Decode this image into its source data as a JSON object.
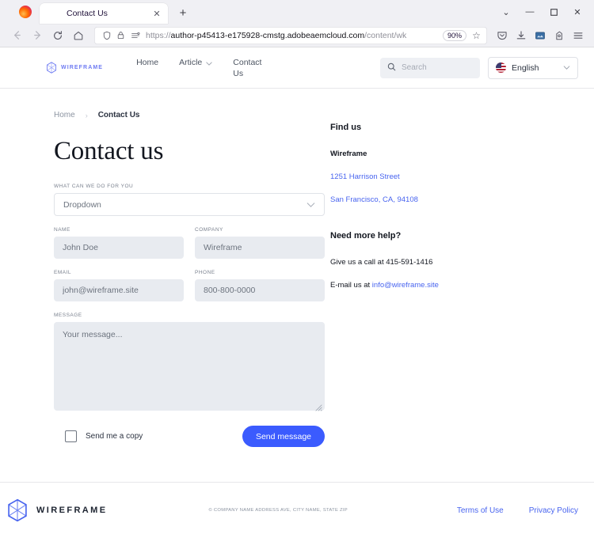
{
  "browser": {
    "tab": {
      "title": "Contact Us",
      "close_label": "✕"
    },
    "new_tab_label": "+",
    "tab_list_caret": "⌄",
    "window_controls": {
      "minimize": "—",
      "maximize": "☐",
      "close": "✕"
    },
    "nav": {
      "back": "←",
      "forward": "→",
      "reload": "⟳",
      "home": "⌂"
    },
    "url": {
      "scheme": "https://",
      "host": "author-p45413-e175928-cmstg.adobeaemcloud.com",
      "path": "/content/wk",
      "full": "https://author-p45413-e175928-cmstg.adobeaemcloud.com/content/wk"
    },
    "zoom_level": "90%",
    "bookmark_star": "☆",
    "toolbar_icons": [
      "pocket-icon",
      "download-icon",
      "screenshot-icon",
      "account-icon",
      "menu-icon"
    ]
  },
  "header": {
    "brand": "WIREFRAME",
    "nav_items": [
      {
        "label": "Home",
        "has_caret": false
      },
      {
        "label": "Article",
        "has_caret": true
      },
      {
        "label": "Contact Us",
        "has_caret": false
      }
    ],
    "search": {
      "placeholder": "Search"
    },
    "language": {
      "selected": "English",
      "flag": "us-flag-icon",
      "caret": "⌄"
    }
  },
  "breadcrumb": {
    "home": "Home",
    "separator": "›",
    "current": "Contact Us"
  },
  "page_title": "Contact us",
  "form": {
    "dropdown": {
      "label": "WHAT CAN WE DO FOR YOU",
      "value": "Dropdown",
      "caret": "⌄"
    },
    "name": {
      "label": "NAME",
      "placeholder": "John Doe"
    },
    "company": {
      "label": "COMPANY",
      "placeholder": "Wireframe"
    },
    "email": {
      "label": "EMAIL",
      "placeholder": "john@wireframe.site"
    },
    "phone": {
      "label": "PHONE",
      "placeholder": "800-800-0000"
    },
    "message": {
      "label": "MESSAGE",
      "placeholder": "Your message..."
    },
    "copy_checkbox_label": "Send me a copy",
    "submit_label": "Send message"
  },
  "sidebar": {
    "find_us": {
      "heading": "Find us",
      "company": "Wireframe",
      "address_line1": "1251 Harrison Street",
      "address_line2": "San Francisco, CA, 94108"
    },
    "help": {
      "heading": "Need more help?",
      "call_text": "Give us a call at 415-591-1416",
      "email_prefix": "E-mail us at ",
      "email": "info@wireframe.site"
    }
  },
  "footer": {
    "brand": "WIREFRAME",
    "copyright": "© COMPANY NAME ADDRESS AVE, CITY NAME, STATE ZIP",
    "links": [
      {
        "label": "Terms of Use"
      },
      {
        "label": "Privacy Policy"
      }
    ]
  },
  "colors": {
    "accent_blue": "#3b5bfe",
    "link_blue": "#4864ef",
    "brand_purple": "#6e7bf2",
    "input_fill": "#e8ebf0"
  }
}
